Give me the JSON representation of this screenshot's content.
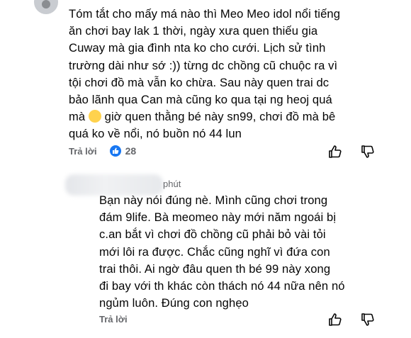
{
  "comment": {
    "text": "Tóm tắt cho mấy má nào thì Meo Meo idol nổi tiếng ăn chơi bay lak 1 thời, ngày xưa quen thiếu gia Cuway mà gia đình nta ko cho cưới. Lịch sử tình trường dài như sớ :)) từng dc chồng cũ chuộc ra vì tội chơi đồ mà vẫn ko chừa. Sau này quen trai dc bảo lãnh qua Can mà cũng ko qua tại ng heoj quá mà 🙂 giờ quen thằng bé này sn99, chơi đồ mà bê quá ko về nổi, nó buồn nó 44 lun",
    "reply_label": "Trả lời",
    "like_count": "28"
  },
  "reply": {
    "time": "phút",
    "text": "Bạn này nói đúng nè. Mình cũng chơi trong đám 9life. Bà meomeo này mới năm ngoái bị c.an bắt vì chơi đồ chồng cũ phải bỏ vài tỏi mới lôi ra được. Chắc cũng nghĩ vì đứa con trai thôi. Ai ngờ đâu quen th bé 99 này xong đi bay với th khác còn thách nó 44 nữa nên nó ngủm luôn. Đúng con nghẹo",
    "reply_label": "Trả lời"
  },
  "colors": {
    "like_blue": "#1877f2",
    "meta_gray": "#65676b"
  },
  "icons": [
    "avatar",
    "like-icon",
    "thumb-up-icon",
    "thumb-down-icon"
  ]
}
